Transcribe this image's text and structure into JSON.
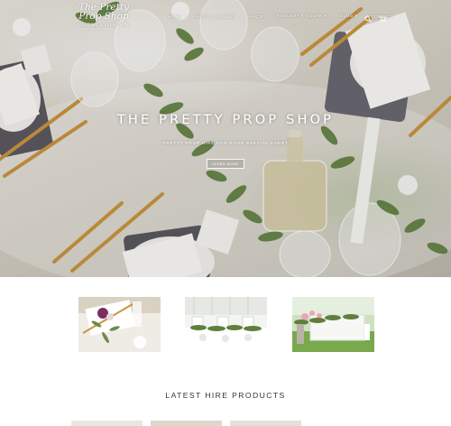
{
  "logo": {
    "line1": "The Pretty",
    "line2": "Prop Shop",
    "tagline": "WEDDING & EVENT HIRE"
  },
  "nav": {
    "items": [
      {
        "label": "HOME"
      },
      {
        "label": "PHOTO GALLERY"
      },
      {
        "label": "FAQ'S"
      },
      {
        "label": "REQUEST A QUOTE ▾"
      },
      {
        "label": "BLOG ▾"
      },
      {
        "label": "CONTACT"
      }
    ],
    "icons": [
      "search-icon",
      "cart-icon"
    ]
  },
  "hero": {
    "title": "THE PRETTY PROP SHOP",
    "subtitle": "PRETTY PROP HIRE FOR YOUR SPECIAL EVENT",
    "button": "LEARN MORE"
  },
  "gallery": {
    "thumbs": [
      "flower-table-setting",
      "marquee-head-table",
      "garden-garland-bench"
    ]
  },
  "latest": {
    "title": "LATEST HIRE PRODUCTS"
  }
}
